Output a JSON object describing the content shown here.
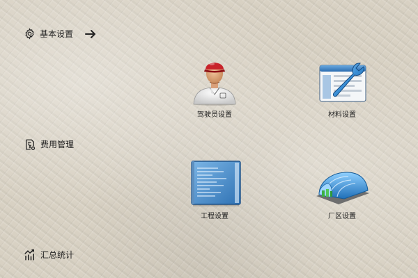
{
  "sidebar": {
    "basic": {
      "label": "基本设置",
      "icon": "gear-icon",
      "has_arrow": true
    },
    "fees": {
      "label": "费用管理",
      "icon": "fee-document-icon"
    },
    "summary": {
      "label": "汇总统计",
      "icon": "chart-icon"
    }
  },
  "tiles": {
    "driver": {
      "label": "驾驶员设置",
      "icon": "driver-icon"
    },
    "material": {
      "label": "材料设置",
      "icon": "wrench-window-icon"
    },
    "project": {
      "label": "工程设置",
      "icon": "blueprint-icon"
    },
    "plant": {
      "label": "厂区设置",
      "icon": "hangar-icon"
    }
  },
  "colors": {
    "background": "#d8d1c3",
    "text": "#222222",
    "accent_blue": "#2f86c8",
    "cap_red": "#c8222a"
  }
}
